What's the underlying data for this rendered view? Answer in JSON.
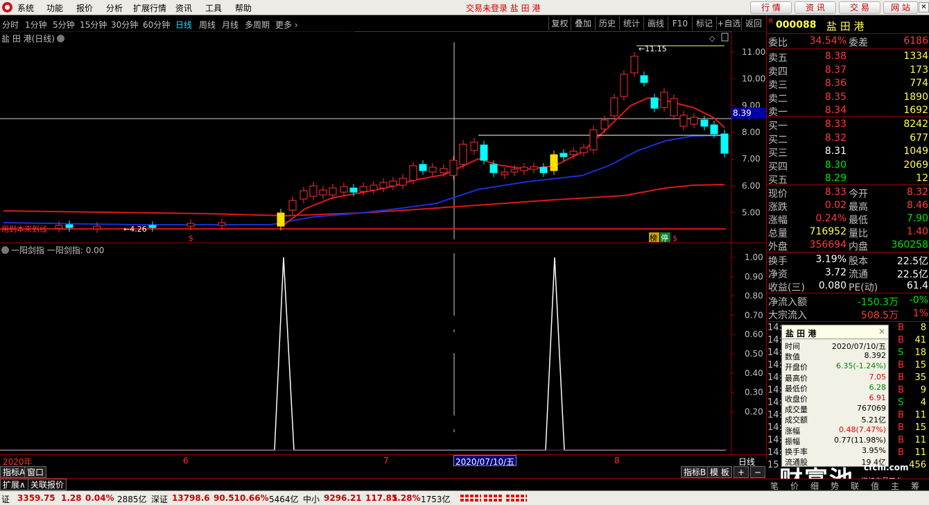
{
  "menu": {
    "items": [
      "系统",
      "功能",
      "报价",
      "分析",
      "扩展行情",
      "资讯",
      "工具",
      "帮助"
    ],
    "status": "交易未登录 盐 田 港",
    "buttons": [
      "行 情",
      "资 讯",
      "交 易",
      "网 站"
    ]
  },
  "periods": [
    "分时",
    "1分钟",
    "5分钟",
    "15分钟",
    "30分钟",
    "60分钟",
    "日线",
    "周线",
    "月线",
    "多周期",
    "更多"
  ],
  "toolbar": [
    "复权",
    "叠加",
    "历史",
    "统计",
    "画线",
    "F10",
    "标记",
    "+自选",
    "返回"
  ],
  "chart": {
    "title": "盐 田 港(日线)",
    "high_label": "11.15",
    "low_label": "4.26",
    "current_line": "8.39",
    "price_ticks": [
      "11.00",
      "10.00",
      "9.00",
      "8.00",
      "7.00",
      "6.00",
      "5.00"
    ],
    "flag1": "榜",
    "flag2": "停",
    "overlay_text": "用到本来到线"
  },
  "indicator": {
    "title": "一阳剑指",
    "subtitle": "一阳剑指: 0.00",
    "ticks": [
      "1.00",
      "0.90",
      "0.80",
      "0.70",
      "0.60",
      "0.50",
      "0.40",
      "0.30",
      "0.20"
    ]
  },
  "axis": {
    "labels": [
      "2020年",
      "6",
      "7",
      "8"
    ],
    "cursor_date": "2020/07/10/五",
    "period_label": "日线"
  },
  "bottom": {
    "left_tabs": [
      "指标A",
      "窗口"
    ],
    "tabs2": [
      "扩展∧",
      "关联报价"
    ],
    "right_tabs": [
      "指标B",
      "模 板",
      "+",
      "−"
    ]
  },
  "quote": {
    "code": "000088",
    "name": "盐 田 港",
    "wb": {
      "label": "委比",
      "value": "34.54%",
      "label2": "委差",
      "value2": "6186"
    },
    "asks": [
      {
        "label": "卖五",
        "price": "8.38",
        "vol": "1334"
      },
      {
        "label": "卖四",
        "price": "8.37",
        "vol": "173"
      },
      {
        "label": "卖三",
        "price": "8.36",
        "vol": "774"
      },
      {
        "label": "卖二",
        "price": "8.35",
        "vol": "1890"
      },
      {
        "label": "卖一",
        "price": "8.34",
        "vol": "1692"
      }
    ],
    "bids": [
      {
        "label": "买一",
        "price": "8.33",
        "vol": "8242"
      },
      {
        "label": "买二",
        "price": "8.32",
        "vol": "677"
      },
      {
        "label": "买三",
        "price": "8.31",
        "vol": "1049"
      },
      {
        "label": "买四",
        "price": "8.30",
        "vol": "2069"
      },
      {
        "label": "买五",
        "price": "8.29",
        "vol": "12"
      }
    ],
    "stats": [
      {
        "l1": "现价",
        "v1": "8.33",
        "c1": "red",
        "l2": "今开",
        "v2": "8.32",
        "c2": "red"
      },
      {
        "l1": "涨跌",
        "v1": "0.02",
        "c1": "red",
        "l2": "最高",
        "v2": "8.46",
        "c2": "red"
      },
      {
        "l1": "涨幅",
        "v1": "0.24%",
        "c1": "red",
        "l2": "最低",
        "v2": "7.90",
        "c2": "grn"
      },
      {
        "l1": "总量",
        "v1": "716952",
        "c1": "yel",
        "l2": "量比",
        "v2": "1.40",
        "c2": "red"
      },
      {
        "l1": "外盘",
        "v1": "356694",
        "c1": "red",
        "l2": "内盘",
        "v2": "360258",
        "c2": "grn"
      }
    ],
    "stats2": [
      {
        "l1": "换手",
        "v1": "3.19%",
        "l2": "股本",
        "v2": "22.5亿"
      },
      {
        "l1": "净资",
        "v1": "3.72",
        "l2": "流通",
        "v2": "22.5亿"
      },
      {
        "l1": "收益(三)",
        "v1": "0.080",
        "l2": "PE(动)",
        "v2": "61.4"
      }
    ],
    "flows": [
      {
        "label": "净流入额",
        "v1": "-150.3万",
        "v2": "-0%",
        "c": "grn"
      },
      {
        "label": "大宗流入",
        "v1": "508.5万",
        "v2": "1%",
        "c": "red"
      }
    ],
    "trades": [
      {
        "t": "14:",
        "s": "B",
        "n": "8"
      },
      {
        "t": "14:",
        "s": "B",
        "n": "41"
      },
      {
        "t": "14:",
        "s": "S",
        "n": "18"
      },
      {
        "t": "14:",
        "s": "B",
        "n": "15"
      },
      {
        "t": "14:",
        "s": "B",
        "n": "35"
      },
      {
        "t": "14:",
        "s": "B",
        "n": "9"
      },
      {
        "t": "14:",
        "s": "S",
        "n": "4"
      },
      {
        "t": "14:",
        "s": "B",
        "n": "11"
      },
      {
        "t": "14:",
        "s": "B",
        "n": "15"
      },
      {
        "t": "14:",
        "s": "B",
        "n": "11"
      },
      {
        "t": "14:",
        "s": "B",
        "n": "11"
      },
      {
        "t": "15",
        "s": "",
        "n": "456"
      }
    ],
    "tabs": [
      "笔",
      "价",
      "细",
      "势",
      "联",
      "值",
      "主",
      "筹"
    ]
  },
  "tooltip": {
    "title": "盐 田 港",
    "rows": [
      {
        "l": "时间",
        "v": "2020/07/10/五",
        "c": "#000"
      },
      {
        "l": "数值",
        "v": "8.392",
        "c": "#000"
      },
      {
        "l": "开盘价",
        "v": "6.35(-1.24%)",
        "c": "#008800"
      },
      {
        "l": "最高价",
        "v": "7.05",
        "c": "#e00000"
      },
      {
        "l": "最低价",
        "v": "6.28",
        "c": "#008800"
      },
      {
        "l": "收盘价",
        "v": "6.91",
        "c": "#e00000"
      },
      {
        "l": "成交量",
        "v": "767069",
        "c": "#000"
      },
      {
        "l": "成交额",
        "v": "5.21亿",
        "c": "#000"
      },
      {
        "l": "涨幅",
        "v": "0.48(7.47%)",
        "c": "#e00000"
      },
      {
        "l": "振幅",
        "v": "0.77(11.98%)",
        "c": "#000"
      },
      {
        "l": "换手率",
        "v": "3.95%",
        "c": "#000"
      },
      {
        "l": "流通股",
        "v": "19.4亿",
        "c": "#000"
      }
    ]
  },
  "status": {
    "items": [
      {
        "name": "证",
        "v1": "3359.75",
        "v2": "1.28",
        "v3": "0.04%",
        "v4": "2885亿"
      },
      {
        "name": "深证",
        "v1": "13798.6",
        "v2": "90.51",
        "v3": "0.66%",
        "v4": "5464亿"
      },
      {
        "name": "中小",
        "v1": "9296.21",
        "v2": "117.85",
        "v3": "1.28%",
        "v4": "1753亿"
      }
    ]
  },
  "watermark": {
    "brand": "财富池",
    "site": "cfchi.com",
    "sub": "指标交易平台"
  }
}
